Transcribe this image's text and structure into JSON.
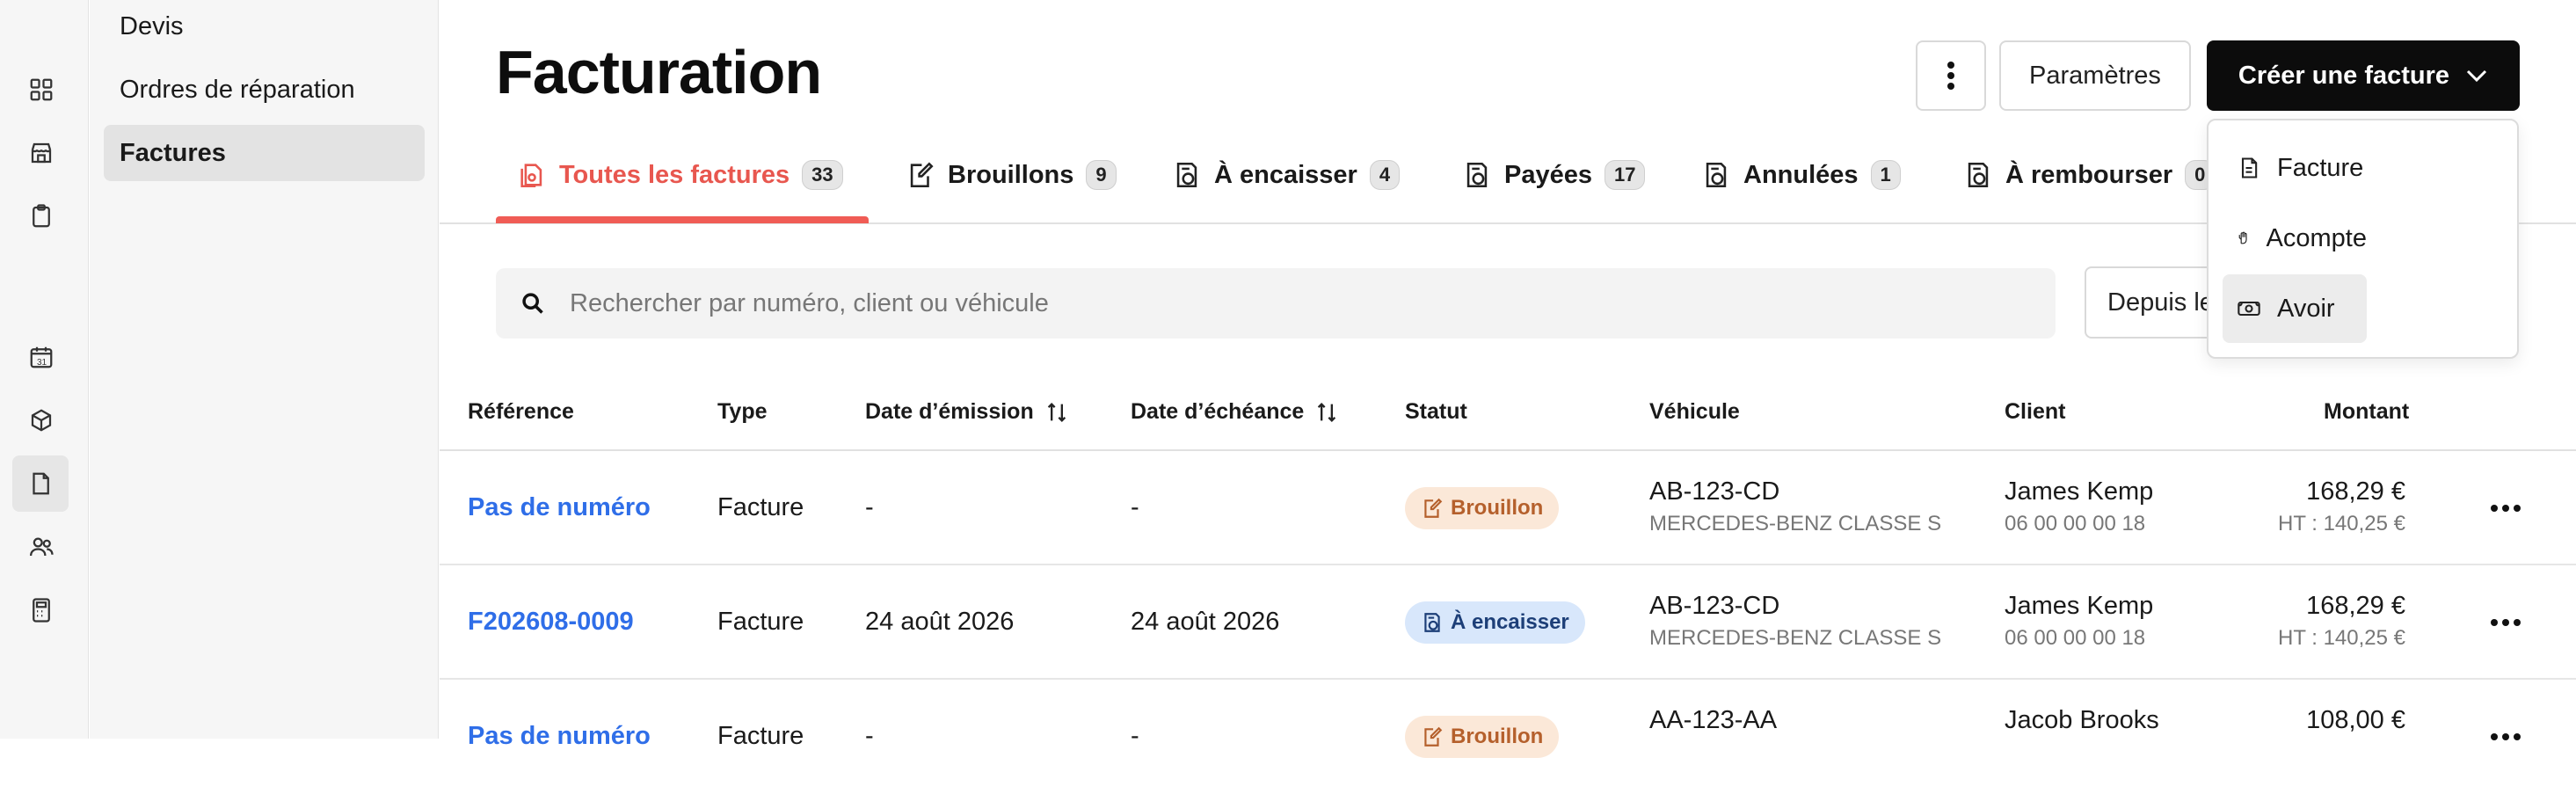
{
  "sidebar": {
    "items": [
      {
        "label": "Devis"
      },
      {
        "label": "Ordres de réparation"
      },
      {
        "label": "Factures"
      }
    ]
  },
  "header": {
    "title": "Facturation",
    "params_label": "Paramètres",
    "create_label": "Créer une facture"
  },
  "tabs": [
    {
      "label": "Toutes les factures",
      "count": "33"
    },
    {
      "label": "Brouillons",
      "count": "9"
    },
    {
      "label": "À encaisser",
      "count": "4"
    },
    {
      "label": "Payées",
      "count": "17"
    },
    {
      "label": "Annulées",
      "count": "1"
    },
    {
      "label": "À rembourser",
      "count": "0"
    }
  ],
  "search": {
    "placeholder": "Rechercher par numéro, client ou véhicule"
  },
  "date_filter_label": "Depuis le",
  "table": {
    "columns": [
      "Référence",
      "Type",
      "Date d’émission",
      "Date d’échéance",
      "Statut",
      "Véhicule",
      "Client",
      "Montant"
    ],
    "rows": [
      {
        "reference": "Pas de numéro",
        "type": "Facture",
        "issue_date": "-",
        "due_date": "-",
        "status": "Brouillon",
        "plate": "AB-123-CD",
        "vehicle": "MERCEDES-BENZ CLASSE S",
        "client": "James Kemp",
        "phone": "06 00 00 00 18",
        "amount": "168,29 €",
        "amount_ht": "HT : 140,25 €"
      },
      {
        "reference": "F202608-0009",
        "type": "Facture",
        "issue_date": "24 août 2026",
        "due_date": "24 août 2026",
        "status": "À encaisser",
        "plate": "AB-123-CD",
        "vehicle": "MERCEDES-BENZ CLASSE S",
        "client": "James Kemp",
        "phone": "06 00 00 00 18",
        "amount": "168,29 €",
        "amount_ht": "HT : 140,25 €"
      },
      {
        "reference": "Pas de numéro",
        "type": "Facture",
        "issue_date": "-",
        "due_date": "-",
        "status": "Brouillon",
        "plate": "AA-123-AA",
        "vehicle": "",
        "client": "Jacob Brooks",
        "phone": "",
        "amount": "108,00 €",
        "amount_ht": ""
      }
    ]
  },
  "dropdown": {
    "items": [
      {
        "label": "Facture",
        "icon": "document-icon"
      },
      {
        "label": "Acompte",
        "icon": "hand-coin-icon"
      },
      {
        "label": "Avoir",
        "icon": "banknote-icon"
      }
    ]
  }
}
